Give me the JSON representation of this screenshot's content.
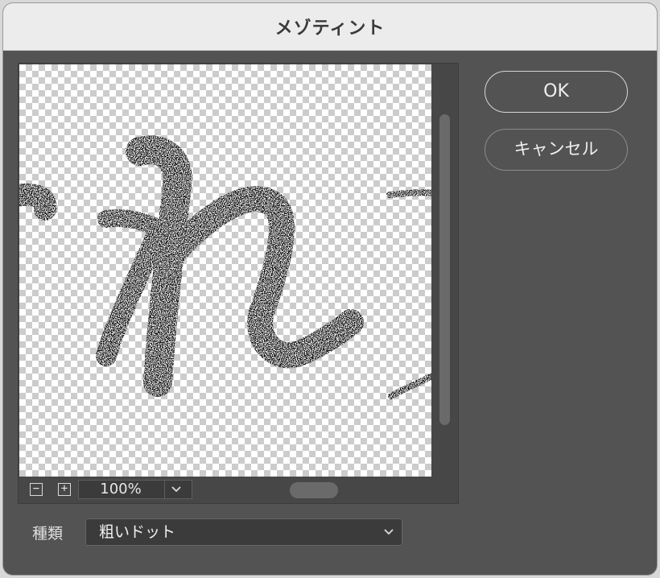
{
  "window": {
    "title": "メゾティント"
  },
  "buttons": {
    "ok_label": "OK",
    "cancel_label": "キャンセル"
  },
  "preview": {
    "zoom": "100%",
    "zoom_out_glyph": "−",
    "zoom_in_glyph": "+"
  },
  "type_field": {
    "label": "種類",
    "value": "粗いドット"
  },
  "colors": {
    "panel": "#535353",
    "titlebar": "#ececec",
    "ink": "#111111"
  }
}
